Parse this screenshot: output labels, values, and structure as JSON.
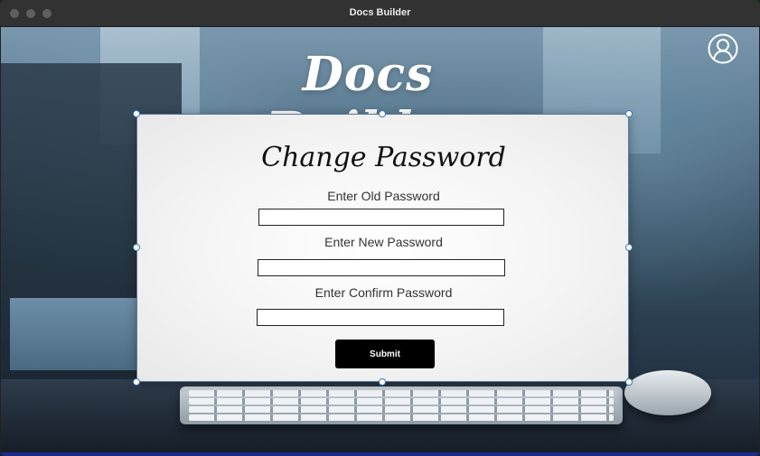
{
  "window": {
    "title": "Docs Builder",
    "traffic_lights": [
      "close",
      "minimize",
      "zoom"
    ]
  },
  "app": {
    "title": "Docs Builder",
    "user_icon": "user-icon"
  },
  "form": {
    "title": "Change Password",
    "old_password_label": "Enter Old Password",
    "old_password_value": "",
    "new_password_label": "Enter New Password",
    "new_password_value": "",
    "confirm_password_label": "Enter Confirm Password",
    "confirm_password_value": "",
    "submit_label": "Submit"
  },
  "colors": {
    "accent_handle": "#3c78b5",
    "submit_bg": "#000000",
    "titlebar": "#323232"
  }
}
